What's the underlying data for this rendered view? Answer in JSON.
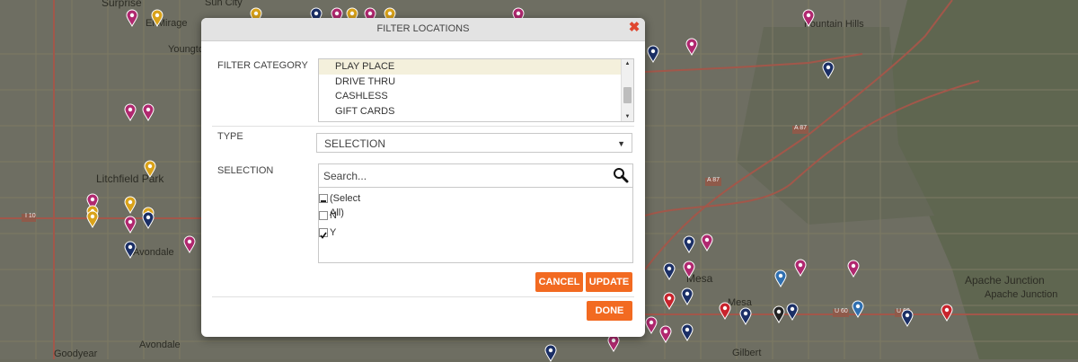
{
  "dialog": {
    "title": "FILTER LOCATIONS",
    "close_label": "✖",
    "filter_category": {
      "label": "FILTER CATEGORY",
      "items": [
        "PLAY PLACE",
        "DRIVE THRU",
        "CASHLESS",
        "GIFT CARDS"
      ],
      "selected": "PLAY PLACE"
    },
    "type": {
      "label": "TYPE",
      "value": "SELECTION"
    },
    "selection": {
      "label": "SELECTION",
      "search_placeholder": "Search...",
      "options": [
        {
          "label": "(Select All)",
          "state": "partial"
        },
        {
          "label": "N",
          "state": "unchecked"
        },
        {
          "label": "Y",
          "state": "checked"
        }
      ]
    },
    "buttons": {
      "cancel": "CANCEL",
      "update": "UPDATE",
      "done": "DONE"
    }
  },
  "map": {
    "places": [
      "Surprise",
      "El Mirage",
      "Sun City",
      "Youngtown",
      "Fountain Hills",
      "Litchfield Park",
      "Avondale",
      "Mesa",
      "Apache Junction",
      "Gilbert",
      "Goodyear"
    ],
    "highway_shields": [
      "I 10",
      "A 87",
      "A 87",
      "U 60",
      "U 60"
    ],
    "pin_colors": {
      "magenta": "#b0286f",
      "navy": "#1b2f66",
      "gold": "#d9a21a",
      "red": "#c8232c",
      "blue": "#2f6fb0",
      "black": "#222222"
    }
  }
}
